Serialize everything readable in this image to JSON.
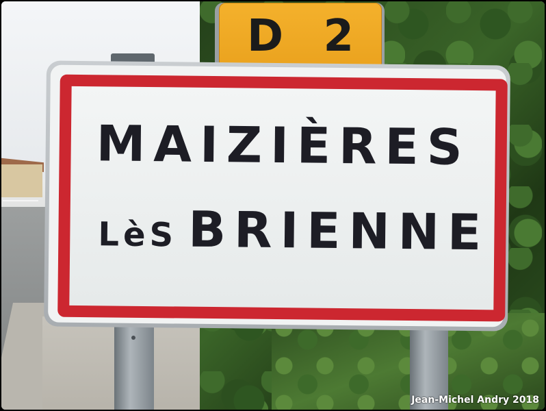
{
  "road_number": "D 2",
  "town_sign": {
    "line1": "MAIZIÈRES",
    "line2_prefix": "LèS",
    "line2_main": "BRIENNE"
  },
  "credit": "Jean-Michel Andry 2018",
  "colors": {
    "sign_border": "#cc2730",
    "road_plate": "#f4b12c",
    "text": "#1d1d25"
  }
}
